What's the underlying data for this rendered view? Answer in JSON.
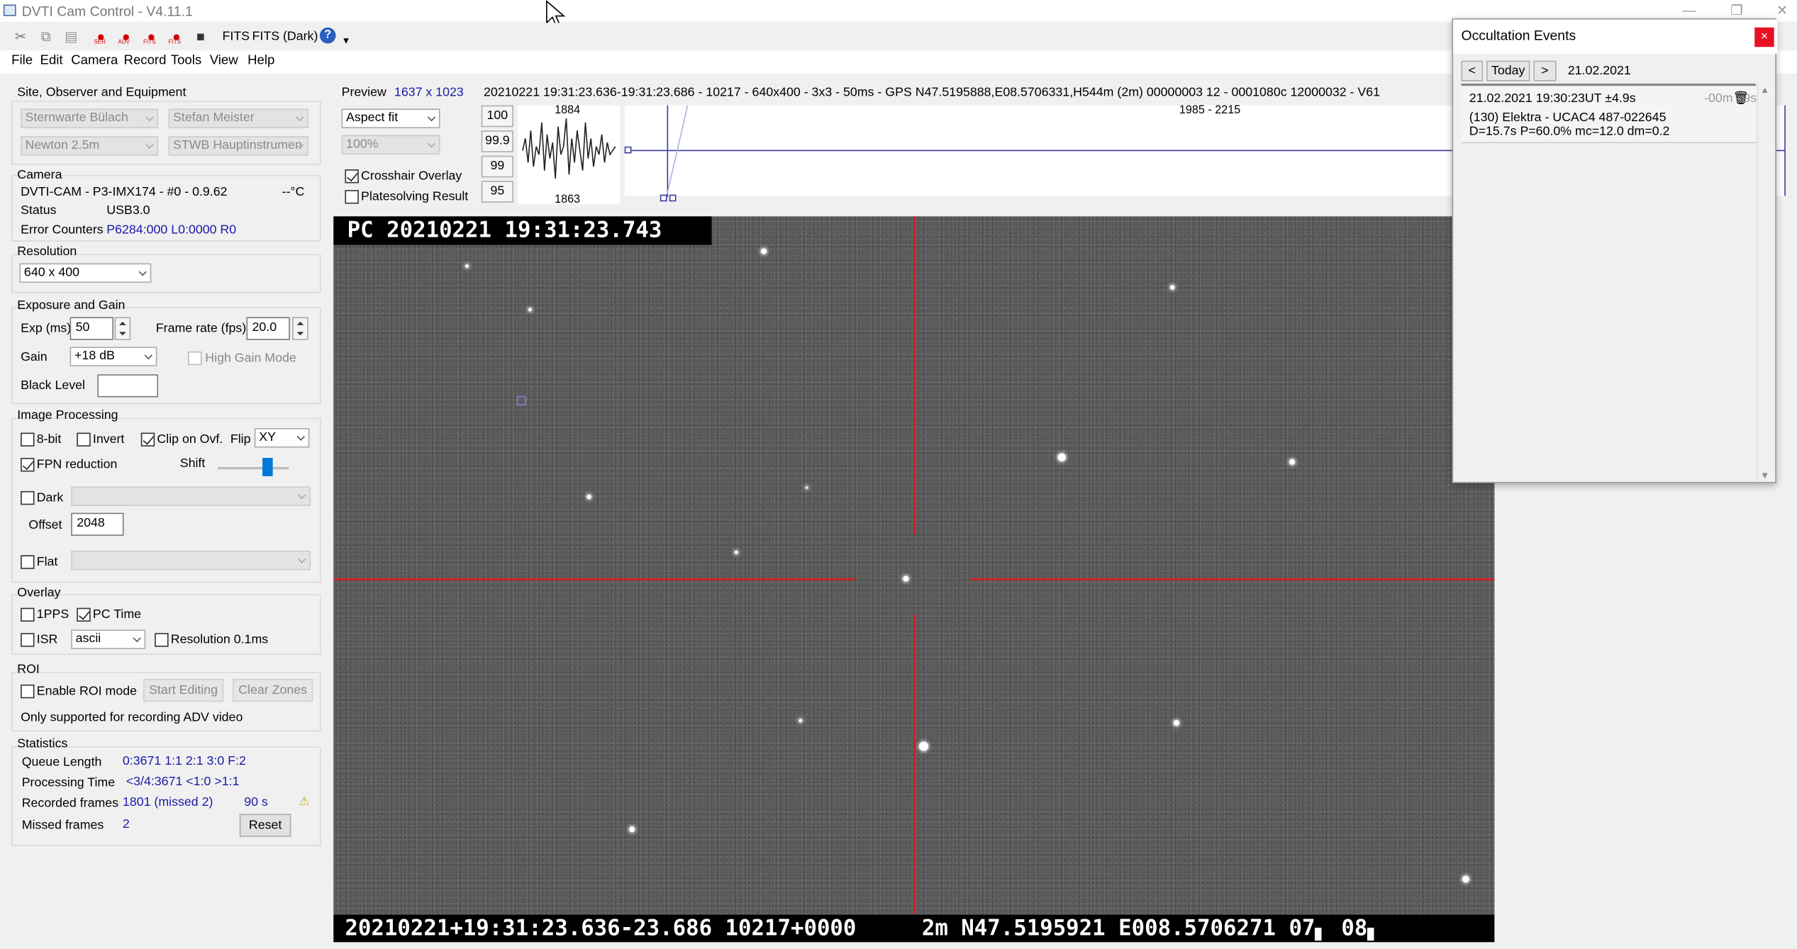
{
  "window": {
    "title": "DVTI Cam Control - V4.11.1"
  },
  "toolbar": {
    "items": [
      "SER",
      "ADV",
      "FITS",
      "FITS"
    ],
    "fits_label": "FITS",
    "fits_dark_label": "FITS (Dark)"
  },
  "menu": [
    "File",
    "Edit",
    "Camera",
    "Record",
    "Tools",
    "View",
    "Help"
  ],
  "site": {
    "title": "Site, Observer and Equipment",
    "observatory": "Sternwarte Bülach",
    "observer": "Stefan Meister",
    "telescope": "Newton 2.5m",
    "instrument": "STWB Hauptinstrumen"
  },
  "camera": {
    "title": "Camera",
    "model": "DVTI-CAM  -  P3-IMX174  -  #0  -  0.9.62",
    "temp": "--°C",
    "status_label": "Status",
    "status": "USB3.0",
    "errors_label": "Error Counters",
    "errors": "P6284:000 L0:0000 R0"
  },
  "resolution": {
    "title": "Resolution",
    "value": "640 x 400"
  },
  "exposure": {
    "title": "Exposure and Gain",
    "exp_label": "Exp (ms)",
    "exp": "50",
    "fps_label": "Frame rate (fps)",
    "fps": "20.0",
    "gain_label": "Gain",
    "gain": "+18 dB",
    "hgm_label": "High Gain Mode",
    "black_label": "Black Level",
    "black": ""
  },
  "processing": {
    "title": "Image Processing",
    "bit8": "8-bit",
    "invert": "Invert",
    "clip": "Clip on Ovf.",
    "flip_label": "Flip",
    "flip": "XY",
    "fpn": "FPN reduction",
    "shift_label": "Shift",
    "dark": "Dark",
    "offset_label": "Offset",
    "offset": "2048",
    "flat": "Flat"
  },
  "overlay": {
    "title": "Overlay",
    "pps": "1PPS",
    "pctime": "PC Time",
    "isr": "ISR",
    "isr_mode": "ascii",
    "res": "Resolution 0.1ms"
  },
  "roi": {
    "title": "ROI",
    "enable": "Enable ROI mode",
    "start": "Start Editing",
    "clear": "Clear Zones",
    "note": "Only supported for recording ADV video"
  },
  "stats": {
    "title": "Statistics",
    "queue_label": "Queue Length",
    "queue": "0:3671  1:1  2:1  3:0  F:2",
    "proc_label": "Processing Time",
    "proc": "<3/4:3671  <1:0  >1:1",
    "rec_label": "Recorded frames",
    "rec": "1801 (missed 2)",
    "rec_time": "90 s",
    "missed_label": "Missed frames",
    "missed": "2",
    "reset": "Reset"
  },
  "preview": {
    "label": "Preview",
    "size": "1637 x 1023",
    "info": "20210221 19:31:23.636-19:31:23.686 - 10217 - 640x400 - 3x3 - 50ms - GPS N47.5195888,E08.5706331,H544m (2m) 00000003 12 - 0001080c 12000032 - V61",
    "fit": "Aspect fit",
    "zoom": "100%",
    "levels": [
      "100",
      "99.9",
      "99",
      "95"
    ],
    "crosshair": "Crosshair Overlay",
    "platesolve": "Platesolving Result",
    "hist_max": "1884",
    "hist_min": "1863",
    "range": "1985 - 2215",
    "histogram": [
      0.55,
      0.7,
      0.4,
      0.8,
      0.35,
      0.6,
      0.5,
      0.9,
      0.3,
      0.75,
      0.45,
      0.65,
      0.2,
      0.85,
      0.5,
      0.6,
      0.95,
      0.25,
      0.7,
      0.4,
      0.8,
      0.55,
      0.3,
      0.9,
      0.45,
      0.7,
      0.35,
      0.6,
      0.5,
      0.75,
      0.4,
      0.65,
      0.5,
      0.55,
      0.6
    ]
  },
  "video": {
    "osd_top": "PC 20210221 19:31:23.743",
    "osd_bottom": "20210221+19:31:23.636-23.686 10217+0000     2m N47.5195921 E008.5706271 07▖ 08▖"
  },
  "occultation": {
    "title": "Occultation Events",
    "prev": "<",
    "today": "Today",
    "next": ">",
    "date": "21.02.2021",
    "event_time": "21.02.2021 19:30:23UT ±4.9s",
    "event_countdown": "-00m 59s",
    "event_target": "(130) Elektra - UCAC4 487-022645",
    "event_params": "D=15.7s   P=60.0%   mc=12.0   dm=0.2",
    "close": "×"
  }
}
